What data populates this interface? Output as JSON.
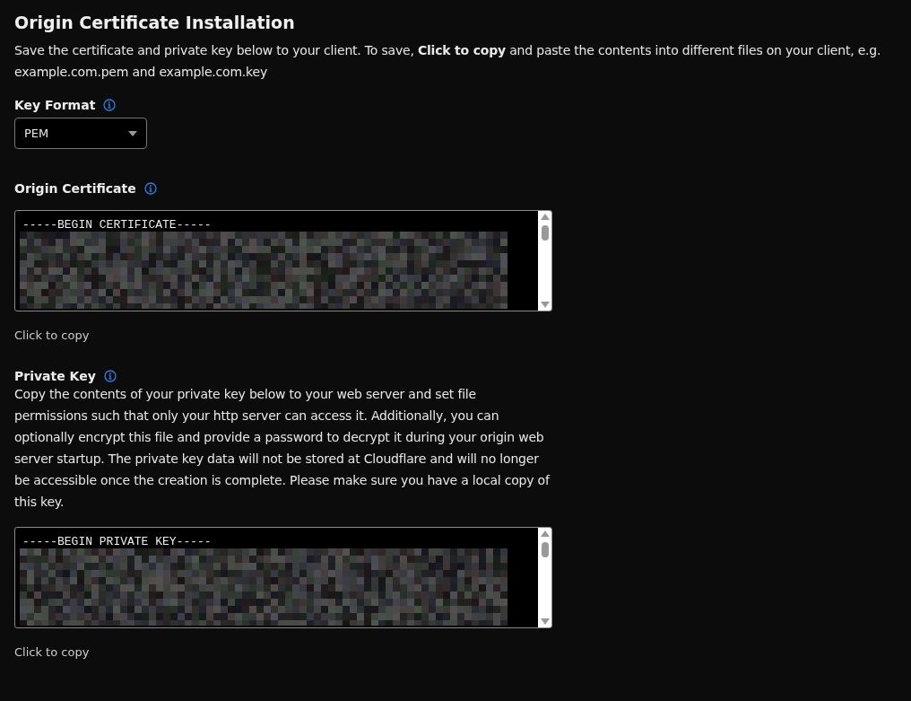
{
  "title": "Origin Certificate Installation",
  "intro": "Save the certificate and private key below to your client. To save, **Click to copy** and paste the contents into different files on your client, e.g. example.com.pem and example.com.key",
  "key_format": {
    "label": "Key Format",
    "value": "PEM"
  },
  "origin_certificate": {
    "label": "Origin Certificate",
    "first_line": "-----BEGIN CERTIFICATE-----",
    "copy_label": "Click to copy"
  },
  "private_key": {
    "label": "Private Key",
    "description": "Copy the contents of your private key below to your web server and set file permissions such that only your http server can access it. Additionally, you can optionally encrypt this file and provide a password to decrypt it during your origin web server startup. The private key data will not be stored at Cloudflare and will no longer be accessible once the creation is complete. Please make sure you have a local copy of this key.",
    "first_line": "-----BEGIN PRIVATE KEY-----",
    "copy_label": "Click to copy"
  }
}
